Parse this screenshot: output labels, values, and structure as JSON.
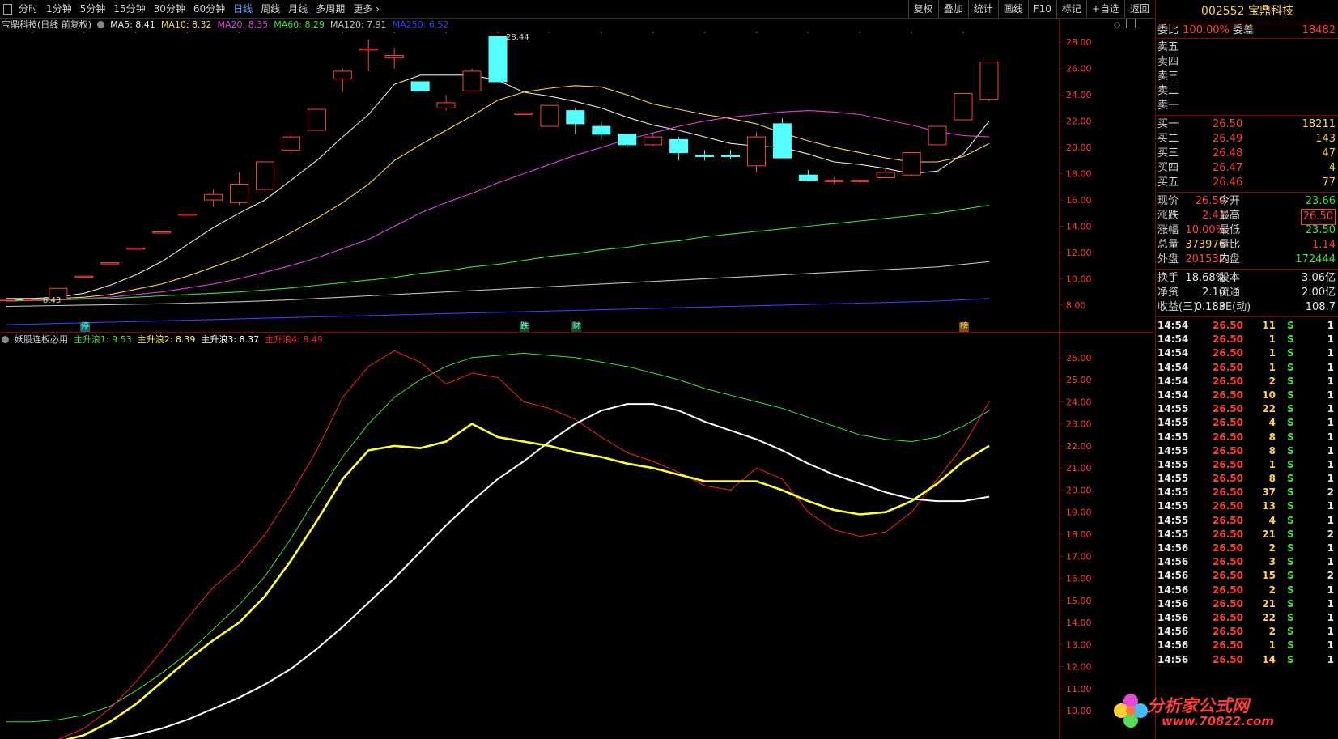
{
  "toolbar": {
    "periods": [
      "分时",
      "1分钟",
      "5分钟",
      "15分钟",
      "30分钟",
      "60分钟",
      "日线",
      "周线",
      "月线",
      "多周期",
      "更多"
    ],
    "active_period": "日线",
    "right_buttons": [
      "复权",
      "叠加",
      "统计",
      "画线",
      "F10",
      "标记",
      "+自选",
      "返回"
    ]
  },
  "main_legend": {
    "title": "宝鼎科技(日线 前复权)",
    "ma5": "MA5: 8.41",
    "ma10": "MA10: 8.32",
    "ma20": "MA20: 8.35",
    "ma60": "MA60: 8.29",
    "ma120": "MA120: 7.91",
    "ma250": "MA250: 6.52"
  },
  "indicator_legend": {
    "title": "妖股连板必用",
    "l1": "主升浪1: 9.53",
    "l2": "主升浪2: 8.39",
    "l3": "主升浪3: 8.37",
    "l4": "主升浪4: 8.49"
  },
  "colors": {
    "up": "#ff4040",
    "down": "#54ffff",
    "ma5": "#e8e8e8",
    "ma10": "#ffd24a",
    "ma20": "#e040e0",
    "ma60": "#3ee03e",
    "ma120": "#c0c0c0",
    "ma250": "#3a3aff",
    "ind1": "#3ee03e",
    "ind2": "#ffff33",
    "ind3": "#ffffff",
    "ind4": "#ff2020"
  },
  "price_axis": [
    "28.00",
    "26.00",
    "24.00",
    "22.00",
    "20.00",
    "18.00",
    "16.00",
    "14.00",
    "12.00",
    "10.00",
    "8.00"
  ],
  "indicator_axis": [
    "26.00",
    "25.00",
    "24.00",
    "23.00",
    "22.00",
    "21.00",
    "20.00",
    "19.00",
    "18.00",
    "17.00",
    "16.00",
    "15.00",
    "14.00",
    "13.00",
    "12.00",
    "11.00",
    "10.00"
  ],
  "annotations": {
    "high_label": "28.44",
    "low_label": "8.43",
    "events": [
      "停",
      "跌",
      "财",
      "榜"
    ]
  },
  "chart_data": [
    {
      "type": "candlestick",
      "title": "宝鼎科技(日线 前复权)",
      "ylim": [
        6.7,
        29
      ],
      "candles": [
        {
          "o": 8.43,
          "c": 8.43,
          "h": 8.43,
          "l": 8.43
        },
        {
          "o": 8.43,
          "c": 8.43,
          "h": 8.43,
          "l": 8.43
        },
        {
          "o": 8.43,
          "c": 9.27,
          "h": 9.27,
          "l": 8.43
        },
        {
          "o": 10.2,
          "c": 10.2,
          "h": 10.2,
          "l": 10.2
        },
        {
          "o": 11.22,
          "c": 11.22,
          "h": 11.22,
          "l": 11.22
        },
        {
          "o": 12.34,
          "c": 12.34,
          "h": 12.34,
          "l": 12.34
        },
        {
          "o": 13.57,
          "c": 13.57,
          "h": 13.57,
          "l": 13.57
        },
        {
          "o": 14.93,
          "c": 14.93,
          "h": 14.93,
          "l": 14.93
        },
        {
          "o": 16.0,
          "c": 16.42,
          "h": 16.8,
          "l": 15.5
        },
        {
          "o": 15.8,
          "c": 17.2,
          "h": 18.1,
          "l": 15.6
        },
        {
          "o": 16.8,
          "c": 18.9,
          "h": 18.9,
          "l": 16.6
        },
        {
          "o": 19.8,
          "c": 20.8,
          "h": 21.2,
          "l": 19.5
        },
        {
          "o": 21.3,
          "c": 22.9,
          "h": 22.9,
          "l": 21.3
        },
        {
          "o": 25.2,
          "c": 25.8,
          "h": 26.0,
          "l": 24.2
        },
        {
          "o": 27.5,
          "c": 27.5,
          "h": 28.2,
          "l": 25.8
        },
        {
          "o": 26.8,
          "c": 27.0,
          "h": 27.6,
          "l": 26.0
        },
        {
          "o": 25.0,
          "c": 24.3,
          "h": 25.0,
          "l": 24.3
        },
        {
          "o": 23.0,
          "c": 23.4,
          "h": 24.0,
          "l": 22.8
        },
        {
          "o": 24.3,
          "c": 25.8,
          "h": 26.0,
          "l": 24.3
        },
        {
          "o": 28.44,
          "c": 25.0,
          "h": 28.44,
          "l": 25.0
        },
        {
          "o": 22.6,
          "c": 22.6,
          "h": 22.6,
          "l": 22.6
        },
        {
          "o": 21.6,
          "c": 23.2,
          "h": 23.2,
          "l": 21.6
        },
        {
          "o": 22.8,
          "c": 21.8,
          "h": 23.0,
          "l": 21.0
        },
        {
          "o": 21.6,
          "c": 21.0,
          "h": 22.0,
          "l": 20.6
        },
        {
          "o": 21.0,
          "c": 20.2,
          "h": 21.0,
          "l": 20.0
        },
        {
          "o": 20.2,
          "c": 20.8,
          "h": 21.0,
          "l": 20.1
        },
        {
          "o": 20.6,
          "c": 19.6,
          "h": 20.8,
          "l": 19.0
        },
        {
          "o": 19.4,
          "c": 19.3,
          "h": 19.8,
          "l": 19.0
        },
        {
          "o": 19.4,
          "c": 19.3,
          "h": 19.8,
          "l": 19.1
        },
        {
          "o": 18.6,
          "c": 20.8,
          "h": 21.2,
          "l": 18.1
        },
        {
          "o": 21.8,
          "c": 19.2,
          "h": 22.2,
          "l": 19.2
        },
        {
          "o": 17.9,
          "c": 17.5,
          "h": 18.3,
          "l": 17.4
        },
        {
          "o": 17.4,
          "c": 17.5,
          "h": 17.7,
          "l": 17.2
        },
        {
          "o": 17.4,
          "c": 17.5,
          "h": 17.5,
          "l": 17.3
        },
        {
          "o": 17.7,
          "c": 18.1,
          "h": 18.5,
          "l": 17.7
        },
        {
          "o": 17.9,
          "c": 19.6,
          "h": 19.6,
          "l": 17.8
        },
        {
          "o": 20.2,
          "c": 21.6,
          "h": 21.6,
          "l": 20.2
        },
        {
          "o": 22.1,
          "c": 24.1,
          "h": 24.1,
          "l": 22.1
        },
        {
          "o": 23.66,
          "c": 26.5,
          "h": 26.5,
          "l": 23.5
        }
      ],
      "series": [
        {
          "name": "MA5",
          "values": [
            8.5,
            8.5,
            8.6,
            8.9,
            9.5,
            10.3,
            11.3,
            12.6,
            13.9,
            15.0,
            16.0,
            17.5,
            19.0,
            20.8,
            22.5,
            24.8,
            25.5,
            25.5,
            25.5,
            25.1,
            24.2,
            23.9,
            23.5,
            23.0,
            22.3,
            21.7,
            21.3,
            20.8,
            20.3,
            20.1,
            20.0,
            19.5,
            18.9,
            18.7,
            18.4,
            18.0,
            18.2,
            19.5,
            22.0
          ]
        },
        {
          "name": "MA10",
          "values": [
            8.4,
            8.4,
            8.5,
            8.6,
            8.8,
            9.2,
            9.6,
            10.2,
            10.9,
            11.6,
            12.5,
            13.5,
            14.6,
            15.8,
            17.2,
            19.0,
            20.2,
            21.3,
            22.4,
            23.6,
            24.2,
            24.5,
            24.7,
            24.6,
            24.0,
            23.3,
            22.9,
            22.5,
            22.2,
            21.8,
            21.1,
            20.5,
            20.0,
            19.6,
            19.2,
            18.9,
            18.9,
            19.3,
            20.3
          ]
        },
        {
          "name": "MA20",
          "values": [
            8.3,
            8.35,
            8.4,
            8.5,
            8.6,
            8.8,
            9.0,
            9.3,
            9.6,
            10.0,
            10.5,
            11.0,
            11.6,
            12.3,
            13.0,
            14.0,
            15.0,
            15.8,
            16.5,
            17.3,
            18.0,
            18.7,
            19.4,
            20.0,
            20.6,
            21.1,
            21.6,
            22.0,
            22.3,
            22.5,
            22.7,
            22.8,
            22.7,
            22.5,
            22.1,
            21.7,
            21.2,
            20.9,
            20.8
          ]
        },
        {
          "name": "MA60",
          "values": [
            8.3,
            8.35,
            8.4,
            8.45,
            8.5,
            8.6,
            8.7,
            8.8,
            8.9,
            9.0,
            9.15,
            9.3,
            9.5,
            9.7,
            9.9,
            10.1,
            10.4,
            10.6,
            10.9,
            11.1,
            11.4,
            11.7,
            11.9,
            12.2,
            12.4,
            12.7,
            12.9,
            13.2,
            13.4,
            13.6,
            13.8,
            14.0,
            14.2,
            14.4,
            14.6,
            14.8,
            15.0,
            15.3,
            15.6
          ]
        },
        {
          "name": "MA120",
          "values": [
            7.9,
            7.93,
            7.96,
            8.0,
            8.03,
            8.07,
            8.1,
            8.15,
            8.2,
            8.25,
            8.32,
            8.4,
            8.5,
            8.6,
            8.7,
            8.8,
            8.9,
            9.0,
            9.1,
            9.2,
            9.3,
            9.4,
            9.5,
            9.6,
            9.7,
            9.8,
            9.9,
            10.0,
            10.1,
            10.2,
            10.3,
            10.4,
            10.5,
            10.6,
            10.7,
            10.8,
            10.9,
            11.1,
            11.3
          ]
        },
        {
          "name": "MA250",
          "values": [
            6.5,
            6.55,
            6.6,
            6.65,
            6.7,
            6.75,
            6.8,
            6.85,
            6.9,
            6.95,
            7.0,
            7.05,
            7.1,
            7.15,
            7.2,
            7.25,
            7.3,
            7.35,
            7.4,
            7.45,
            7.5,
            7.55,
            7.6,
            7.65,
            7.7,
            7.75,
            7.8,
            7.85,
            7.9,
            7.95,
            8.0,
            8.05,
            8.1,
            8.15,
            8.2,
            8.25,
            8.3,
            8.4,
            8.5
          ]
        }
      ]
    },
    {
      "type": "line",
      "title": "妖股连板必用",
      "ylim": [
        9.2,
        26.8
      ],
      "series": [
        {
          "name": "主升浪1",
          "values": [
            9.5,
            9.5,
            9.6,
            9.8,
            10.2,
            10.9,
            11.7,
            12.6,
            13.7,
            14.8,
            16.1,
            17.8,
            19.7,
            21.5,
            23.0,
            24.2,
            25.0,
            25.6,
            26.0,
            26.1,
            26.2,
            26.1,
            26.0,
            25.8,
            25.6,
            25.3,
            25.0,
            24.6,
            24.3,
            24.0,
            23.7,
            23.3,
            22.9,
            22.5,
            22.3,
            22.2,
            22.4,
            22.9,
            23.6
          ]
        },
        {
          "name": "主升浪2",
          "values": [
            8.4,
            8.45,
            8.6,
            8.9,
            9.5,
            10.3,
            11.3,
            12.3,
            13.2,
            14.0,
            15.2,
            16.8,
            18.6,
            20.5,
            21.8,
            22.0,
            21.9,
            22.2,
            23.0,
            22.4,
            22.2,
            22.0,
            21.7,
            21.5,
            21.2,
            21.0,
            20.7,
            20.4,
            20.4,
            20.4,
            20.0,
            19.5,
            19.1,
            18.9,
            19.0,
            19.5,
            20.3,
            21.3,
            22.0
          ]
        },
        {
          "name": "主升浪3",
          "values": [
            8.4,
            8.4,
            8.45,
            8.55,
            8.7,
            8.9,
            9.2,
            9.6,
            10.1,
            10.6,
            11.2,
            11.9,
            12.8,
            13.8,
            14.9,
            16.0,
            17.2,
            18.4,
            19.5,
            20.5,
            21.3,
            22.2,
            23.0,
            23.6,
            23.9,
            23.9,
            23.6,
            23.1,
            22.7,
            22.3,
            21.8,
            21.2,
            20.7,
            20.3,
            19.9,
            19.6,
            19.5,
            19.5,
            19.7
          ]
        },
        {
          "name": "主升浪4",
          "values": [
            8.5,
            8.5,
            8.7,
            9.2,
            10.1,
            11.3,
            12.7,
            14.2,
            15.6,
            16.6,
            18.0,
            19.8,
            21.8,
            24.2,
            25.6,
            26.3,
            25.8,
            24.8,
            25.3,
            25.1,
            24.0,
            23.7,
            23.2,
            22.4,
            21.7,
            21.3,
            20.8,
            20.2,
            20.0,
            21.0,
            20.5,
            19.0,
            18.2,
            17.9,
            18.1,
            19.0,
            20.5,
            22.0,
            24.0
          ]
        }
      ]
    }
  ],
  "quote": {
    "code_name": "002552 宝鼎科技",
    "weibi_label": "委比",
    "weibi": "100.00%",
    "weicha_label": "委差",
    "weicha": "18482",
    "asks": [
      {
        "label": "卖五"
      },
      {
        "label": "卖四"
      },
      {
        "label": "卖三"
      },
      {
        "label": "卖二"
      },
      {
        "label": "卖一"
      }
    ],
    "bids": [
      {
        "label": "买一",
        "price": "26.50",
        "vol": "18211"
      },
      {
        "label": "买二",
        "price": "26.49",
        "vol": "143"
      },
      {
        "label": "买三",
        "price": "26.48",
        "vol": "47"
      },
      {
        "label": "买四",
        "price": "26.47",
        "vol": "4"
      },
      {
        "label": "买五",
        "price": "26.46",
        "vol": "77"
      }
    ],
    "stats": [
      {
        "l1": "现价",
        "v1": "26.50",
        "c1": "red",
        "l2": "今开",
        "v2": "23.66",
        "c2": "green"
      },
      {
        "l1": "涨跌",
        "v1": "2.41",
        "c1": "red",
        "l2": "最高",
        "v2": "26.50",
        "c2": "red",
        "boxed": true
      },
      {
        "l1": "涨幅",
        "v1": "10.00%",
        "c1": "red",
        "l2": "最低",
        "v2": "23.50",
        "c2": "green"
      },
      {
        "l1": "总量",
        "v1": "373976",
        "c1": "yellow",
        "l2": "量比",
        "v2": "1.14",
        "c2": "red"
      },
      {
        "l1": "外盘",
        "v1": "201532",
        "c1": "red",
        "l2": "内盘",
        "v2": "172444",
        "c2": "green"
      }
    ],
    "stats2": [
      {
        "l1": "换手",
        "v1": "18.68%",
        "l2": "股本",
        "v2": "3.06亿"
      },
      {
        "l1": "净资",
        "v1": "2.16",
        "l2": "流通",
        "v2": "2.00亿"
      },
      {
        "l1": "收益(三)",
        "v1": "0.183",
        "l2": "PE(动)",
        "v2": "108.7"
      }
    ],
    "ticks": [
      {
        "t": "14:54",
        "p": "26.50",
        "v": "11",
        "s": "S",
        "n": "1"
      },
      {
        "t": "14:54",
        "p": "26.50",
        "v": "1",
        "s": "S",
        "n": "1"
      },
      {
        "t": "14:54",
        "p": "26.50",
        "v": "1",
        "s": "S",
        "n": "1"
      },
      {
        "t": "14:54",
        "p": "26.50",
        "v": "1",
        "s": "S",
        "n": "1"
      },
      {
        "t": "14:54",
        "p": "26.50",
        "v": "2",
        "s": "S",
        "n": "1"
      },
      {
        "t": "14:54",
        "p": "26.50",
        "v": "10",
        "s": "S",
        "n": "1"
      },
      {
        "t": "14:55",
        "p": "26.50",
        "v": "22",
        "s": "S",
        "n": "1"
      },
      {
        "t": "14:55",
        "p": "26.50",
        "v": "4",
        "s": "S",
        "n": "1"
      },
      {
        "t": "14:55",
        "p": "26.50",
        "v": "8",
        "s": "S",
        "n": "1"
      },
      {
        "t": "14:55",
        "p": "26.50",
        "v": "8",
        "s": "S",
        "n": "1"
      },
      {
        "t": "14:55",
        "p": "26.50",
        "v": "1",
        "s": "S",
        "n": "1"
      },
      {
        "t": "14:55",
        "p": "26.50",
        "v": "8",
        "s": "S",
        "n": "1"
      },
      {
        "t": "14:55",
        "p": "26.50",
        "v": "37",
        "s": "S",
        "n": "2"
      },
      {
        "t": "14:55",
        "p": "26.50",
        "v": "13",
        "s": "S",
        "n": "1"
      },
      {
        "t": "14:55",
        "p": "26.50",
        "v": "4",
        "s": "S",
        "n": "1"
      },
      {
        "t": "14:55",
        "p": "26.50",
        "v": "21",
        "s": "S",
        "n": "2"
      },
      {
        "t": "14:56",
        "p": "26.50",
        "v": "2",
        "s": "S",
        "n": "1"
      },
      {
        "t": "14:56",
        "p": "26.50",
        "v": "3",
        "s": "S",
        "n": "1"
      },
      {
        "t": "14:56",
        "p": "26.50",
        "v": "15",
        "s": "S",
        "n": "2"
      },
      {
        "t": "14:56",
        "p": "26.50",
        "v": "2",
        "s": "S",
        "n": "1"
      },
      {
        "t": "14:56",
        "p": "26.50",
        "v": "21",
        "s": "S",
        "n": "1"
      },
      {
        "t": "14:56",
        "p": "26.50",
        "v": "22",
        "s": "S",
        "n": "1"
      },
      {
        "t": "14:56",
        "p": "26.50",
        "v": "2",
        "s": "S",
        "n": "1"
      },
      {
        "t": "14:56",
        "p": "26.50",
        "v": "1",
        "s": "S",
        "n": "1"
      },
      {
        "t": "14:56",
        "p": "26.50",
        "v": "14",
        "s": "S",
        "n": "1"
      }
    ]
  },
  "watermark": {
    "name": "分析家公式网",
    "url": "www.70822.com"
  }
}
